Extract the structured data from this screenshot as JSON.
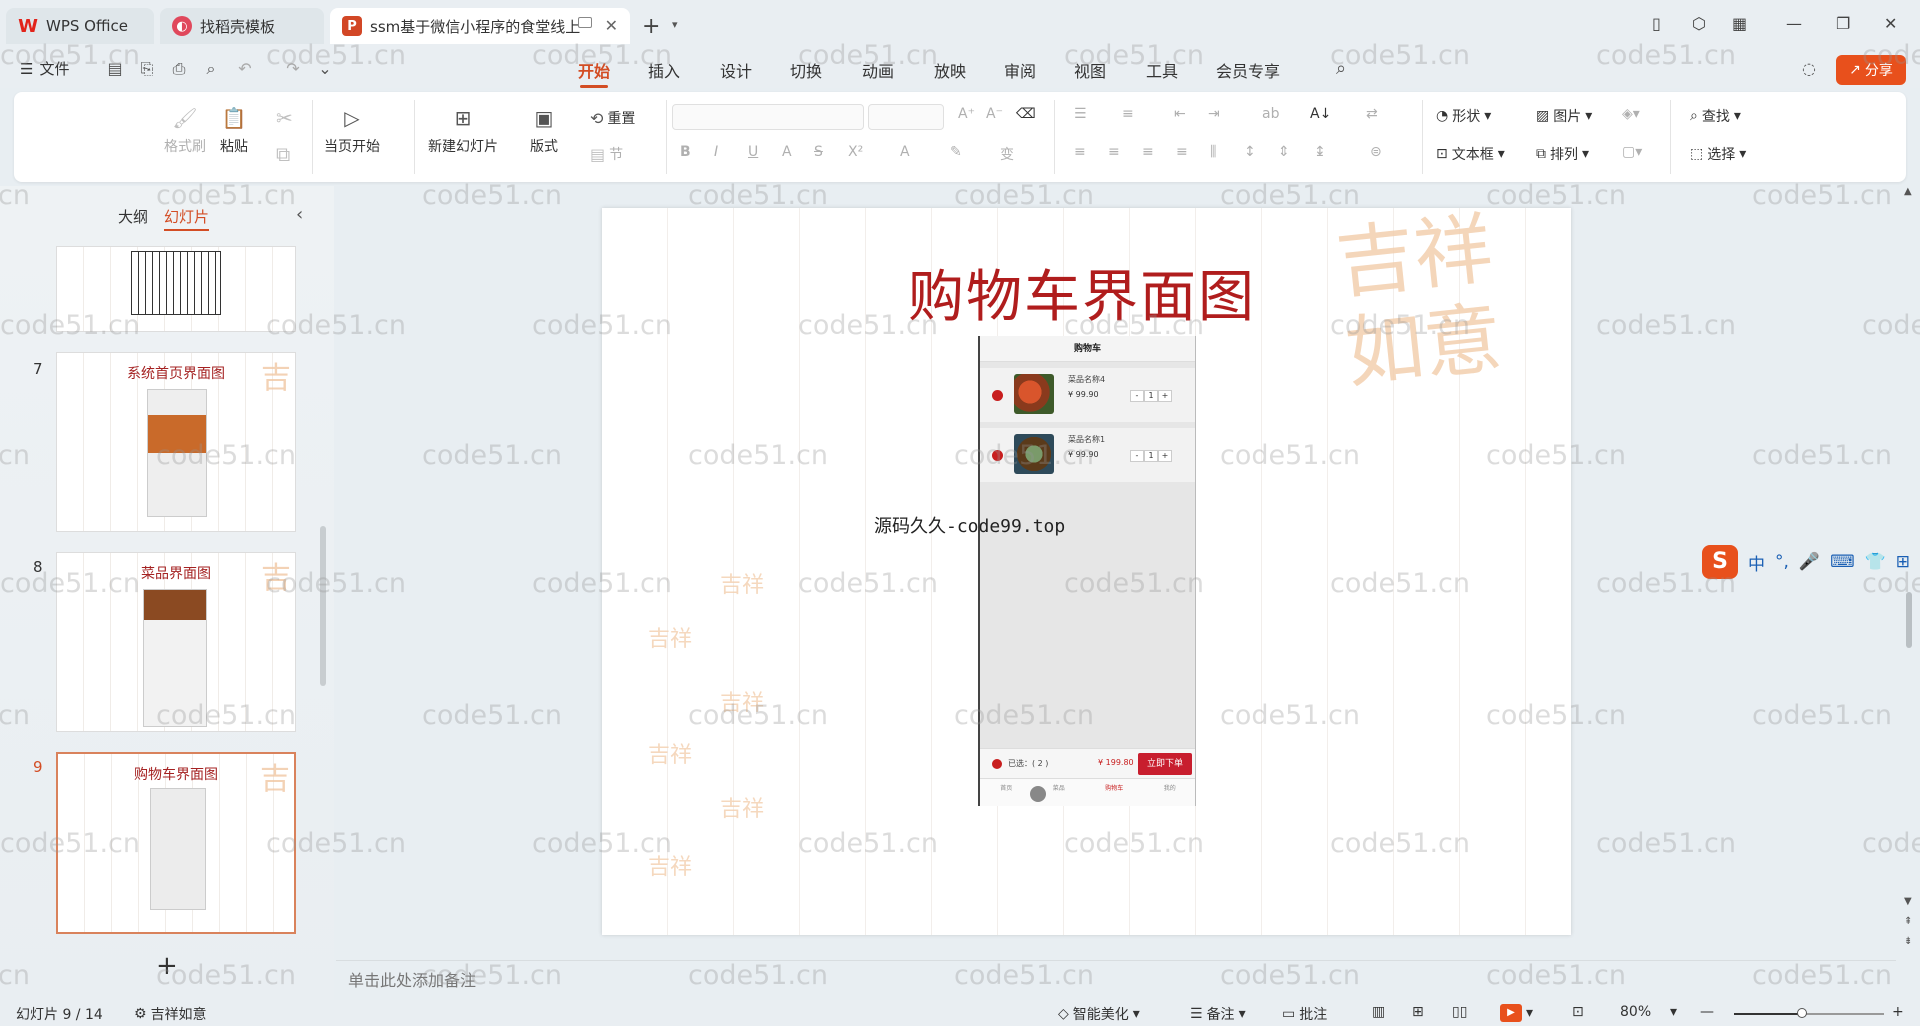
{
  "tabs": [
    {
      "label": "WPS Office",
      "icon": "wps-logo-icon"
    },
    {
      "label": "找稻壳模板",
      "icon": "daoke-icon"
    },
    {
      "label": "ssm基于微信小程序的食堂线上预约点餐系统",
      "icon": "ppt-icon"
    }
  ],
  "menu": {
    "file": "文件",
    "tabs": [
      "开始",
      "插入",
      "设计",
      "切换",
      "动画",
      "放映",
      "审阅",
      "视图",
      "工具",
      "会员专享"
    ],
    "share": "分享"
  },
  "ribbon": {
    "format_painter": "格式刷",
    "paste": "粘贴",
    "play_from_current": "当页开始",
    "new_slide": "新建幻灯片",
    "layout": "版式",
    "reset": "重置",
    "section": "节",
    "shape": "形状",
    "picture": "图片",
    "find": "查找",
    "textbox": "文本框",
    "arrange": "排列",
    "select": "选择"
  },
  "left_panel": {
    "outline_tab": "大纲",
    "slides_tab": "幻灯片",
    "thumbnails": [
      {
        "num": "7",
        "title": "系统首页界面图"
      },
      {
        "num": "8",
        "title": "菜品界面图"
      },
      {
        "num": "9",
        "title": "购物车界面图"
      }
    ]
  },
  "slide": {
    "title": "购物车界面图",
    "watermark_text": "源码久久-code99.top",
    "stamp_text": "吉祥如意",
    "phone": {
      "header": "购物车",
      "items": [
        {
          "name": "菜品名称4",
          "price": "¥ 99.90",
          "qty": "1"
        },
        {
          "name": "菜品名称1",
          "price": "¥ 99.90",
          "qty": "1"
        }
      ],
      "selected": "已选：( 2 )",
      "total": "¥ 199.80",
      "order_button": "立即下单",
      "nav": [
        "首页",
        "菜品",
        "购物车",
        "我的"
      ]
    }
  },
  "notes_placeholder": "单击此处添加备注",
  "status": {
    "slide_counter": "幻灯片 9 / 14",
    "theme": "吉祥如意",
    "beautify": "智能美化",
    "notes": "备注",
    "comments": "批注",
    "zoom": "80%",
    "zoom_level": 0.45
  },
  "ime": {
    "lang": "中"
  },
  "watermark": "code51.cn"
}
